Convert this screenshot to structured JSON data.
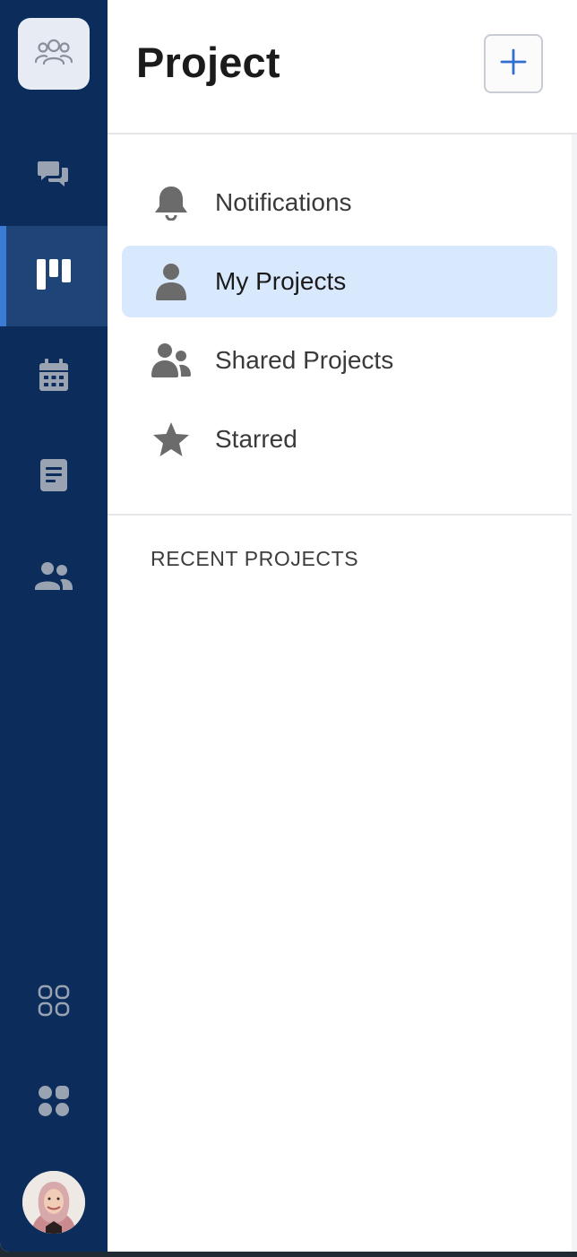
{
  "rail": {
    "logo_icon": "team-icon",
    "items": [
      {
        "icon": "chat-icon",
        "active": false
      },
      {
        "icon": "kanban-board-icon",
        "active": true
      },
      {
        "icon": "calendar-icon",
        "active": false
      },
      {
        "icon": "document-icon",
        "active": false
      },
      {
        "icon": "people-icon",
        "active": false
      }
    ],
    "bottom_items": [
      {
        "icon": "apps-outline-icon"
      },
      {
        "icon": "apps-filled-icon"
      }
    ],
    "avatar": "user-avatar"
  },
  "panel": {
    "title": "Project",
    "add_icon": "plus-icon",
    "nav": [
      {
        "label": "Notifications",
        "icon": "bell-icon",
        "active": false
      },
      {
        "label": "My Projects",
        "icon": "person-icon",
        "active": true
      },
      {
        "label": "Shared Projects",
        "icon": "group-icon",
        "active": false
      },
      {
        "label": "Starred",
        "icon": "star-icon",
        "active": false
      }
    ],
    "recent_title": "RECENT PROJECTS"
  },
  "colors": {
    "rail_bg": "#0c2d5c",
    "rail_active": "#1f4578",
    "accent": "#3a7bd5",
    "active_item_bg": "#d9e9fd",
    "icon_gray": "#6b6b6b"
  }
}
